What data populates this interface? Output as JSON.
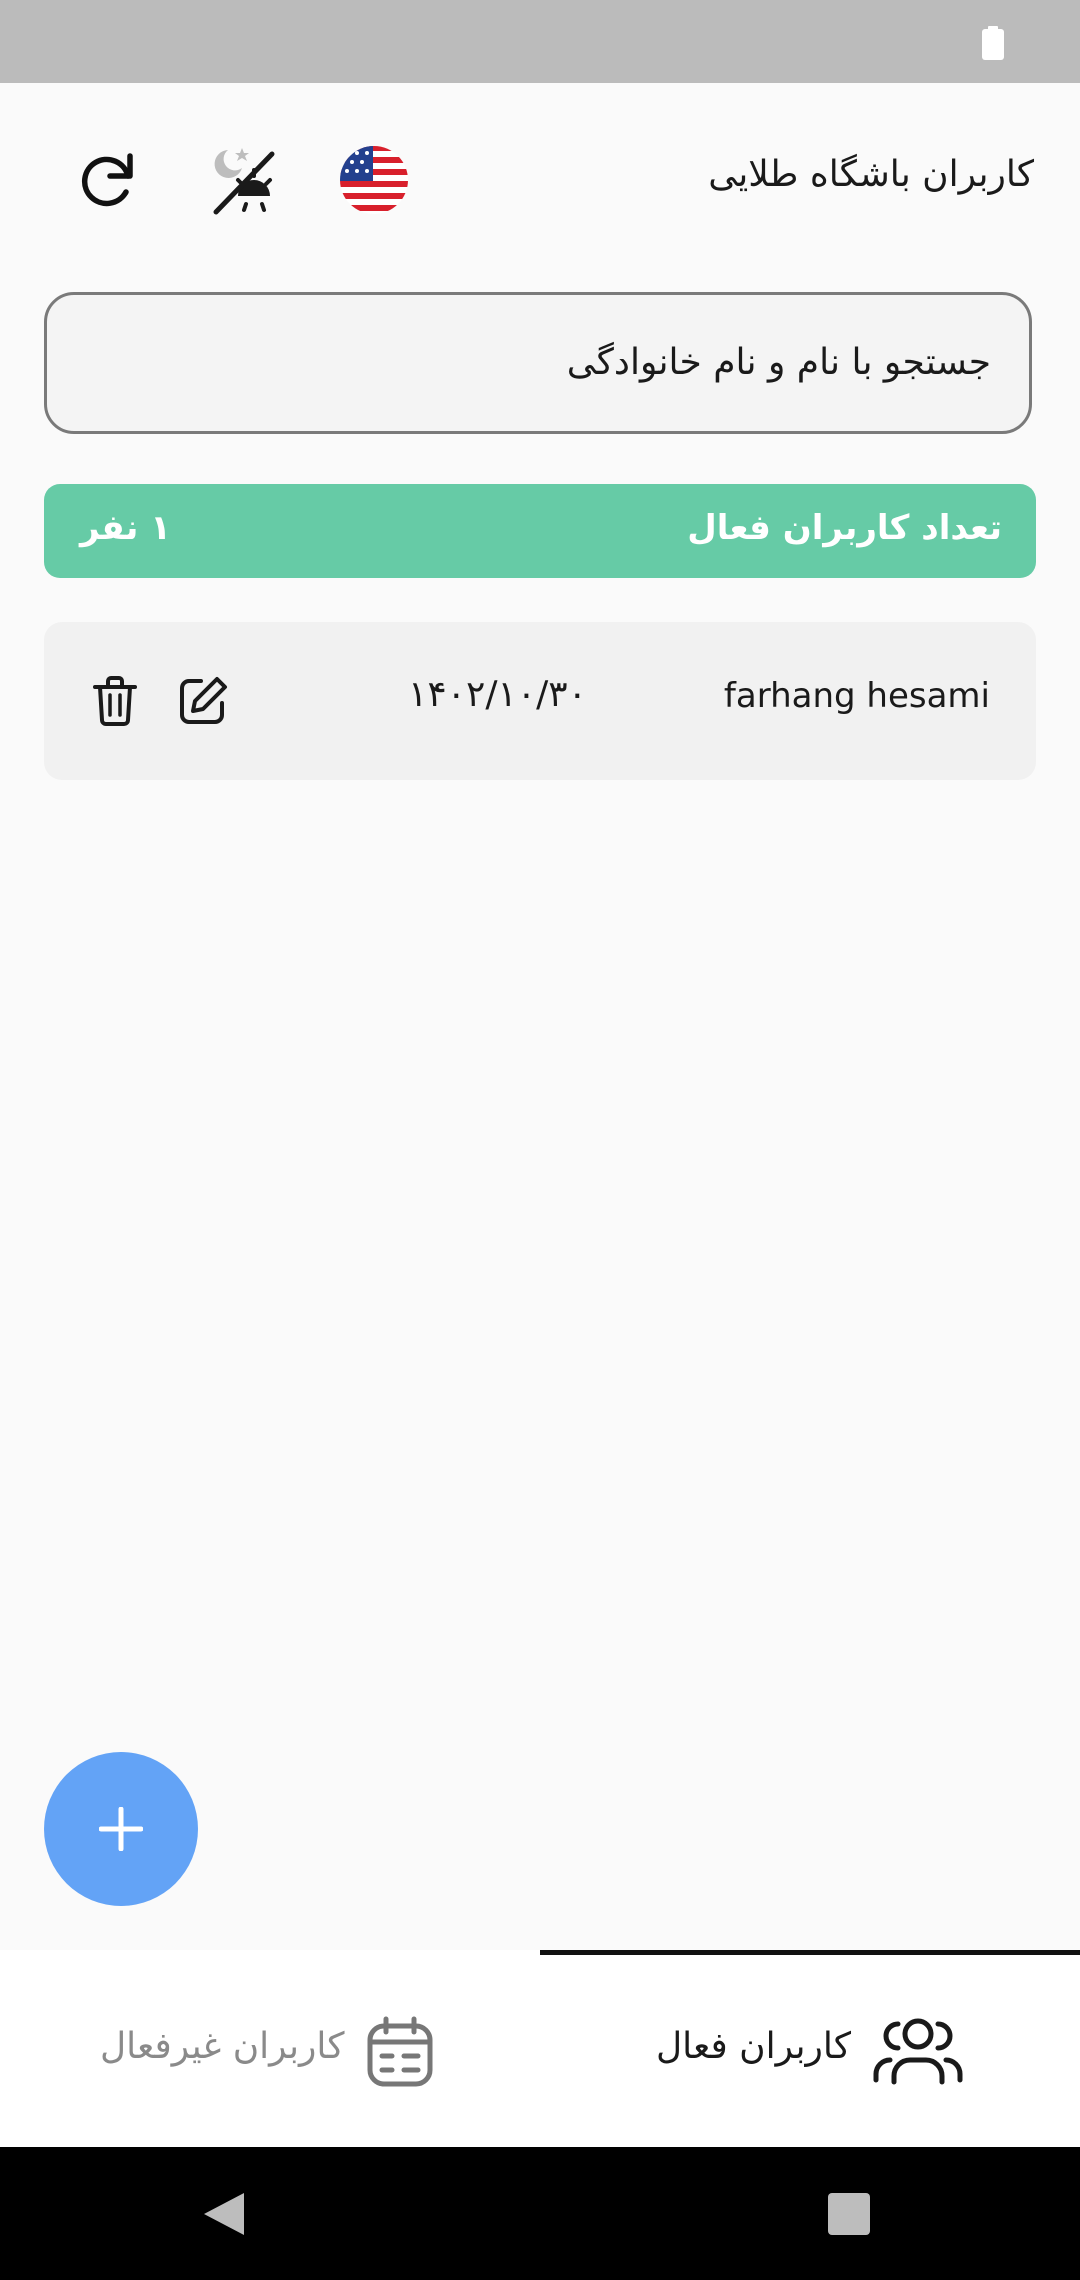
{
  "header": {
    "title": "کاربران باشگاه طلایی"
  },
  "search": {
    "placeholder": "جستجو با نام و نام خانوادگی"
  },
  "summary": {
    "label": "تعداد کاربران فعال",
    "count": "۱ نفر"
  },
  "users": [
    {
      "name": "farhang hesami",
      "date": "۱۴۰۲/۱۰/۳۰"
    }
  ],
  "tabs": [
    {
      "label": "کاربران فعال",
      "active": true,
      "icon": "users-icon"
    },
    {
      "label": "کاربران غیرفعال",
      "active": false,
      "icon": "calendar-icon"
    }
  ],
  "colors": {
    "accent_green": "#66cba6",
    "fab_blue": "#63a3f6",
    "status_bar": "#bbbbbb"
  }
}
